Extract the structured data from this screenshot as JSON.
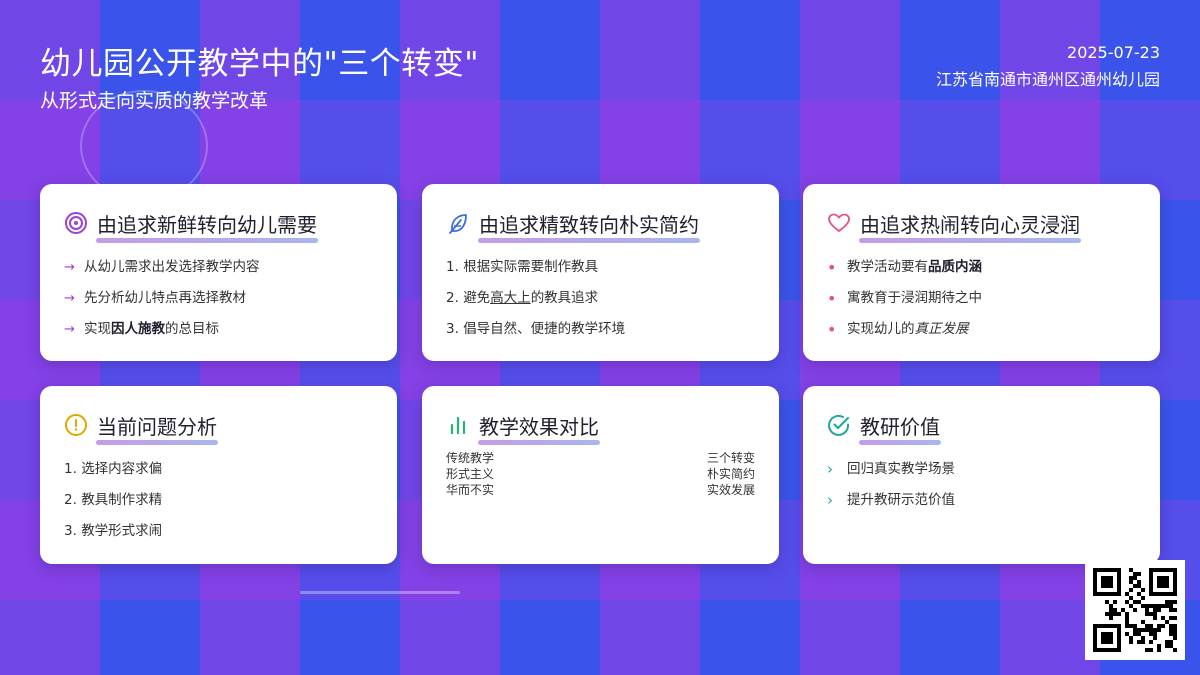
{
  "header": {
    "title": "幼儿园公开教学中的\"三个转变\"",
    "subtitle": "从形式走向实质的教学改革",
    "date": "2025-07-23",
    "school": "江苏省南通市通州区通州幼儿园"
  },
  "cards": {
    "c1": {
      "title": "由追求新鲜转向幼儿需要",
      "icon": "target-icon",
      "items": [
        {
          "text": "从幼儿需求出发选择教学内容"
        },
        {
          "text": "先分析幼儿特点再选择教材"
        },
        {
          "pre": "实现",
          "bold": "因人施教",
          "post": "的总目标"
        }
      ]
    },
    "c2": {
      "title": "由追求精致转向朴实简约",
      "icon": "feather-icon",
      "items": [
        {
          "num": "1.",
          "text": "根据实际需要制作教具"
        },
        {
          "num": "2.",
          "pre": "避免",
          "under": "高大上",
          "post": "的教具追求"
        },
        {
          "num": "3.",
          "text": "倡导自然、便捷的教学环境"
        }
      ]
    },
    "c3": {
      "title": "由追求热闹转向心灵浸润",
      "icon": "heart-icon",
      "items": [
        {
          "pre": "教学活动要有",
          "bold": "品质内涵"
        },
        {
          "text": "寓教育于浸润期待之中"
        },
        {
          "pre": "实现幼儿的",
          "italic": "真正发展"
        }
      ]
    },
    "c4": {
      "title": "当前问题分析",
      "icon": "alert-icon",
      "items": [
        {
          "num": "1.",
          "text": "选择内容求偏"
        },
        {
          "num": "2.",
          "text": "教具制作求精"
        },
        {
          "num": "3.",
          "text": "教学形式求闹"
        }
      ]
    },
    "c5": {
      "title": "教学效果对比",
      "icon": "bar-chart-icon",
      "left": [
        "传统教学",
        "形式主义",
        "华而不实"
      ],
      "right": [
        "三个转变",
        "朴实简约",
        "实效发展"
      ]
    },
    "c6": {
      "title": "教研价值",
      "icon": "check-circle-icon",
      "items": [
        {
          "text": "回归真实教学场景"
        },
        {
          "text": "提升教研示范价值"
        }
      ]
    }
  },
  "colors": {
    "arrow": "#9b40d8",
    "dot": "#e4508c",
    "chevron": "#1aa99c",
    "alert": "#e0a800",
    "chart": "#22b573"
  }
}
